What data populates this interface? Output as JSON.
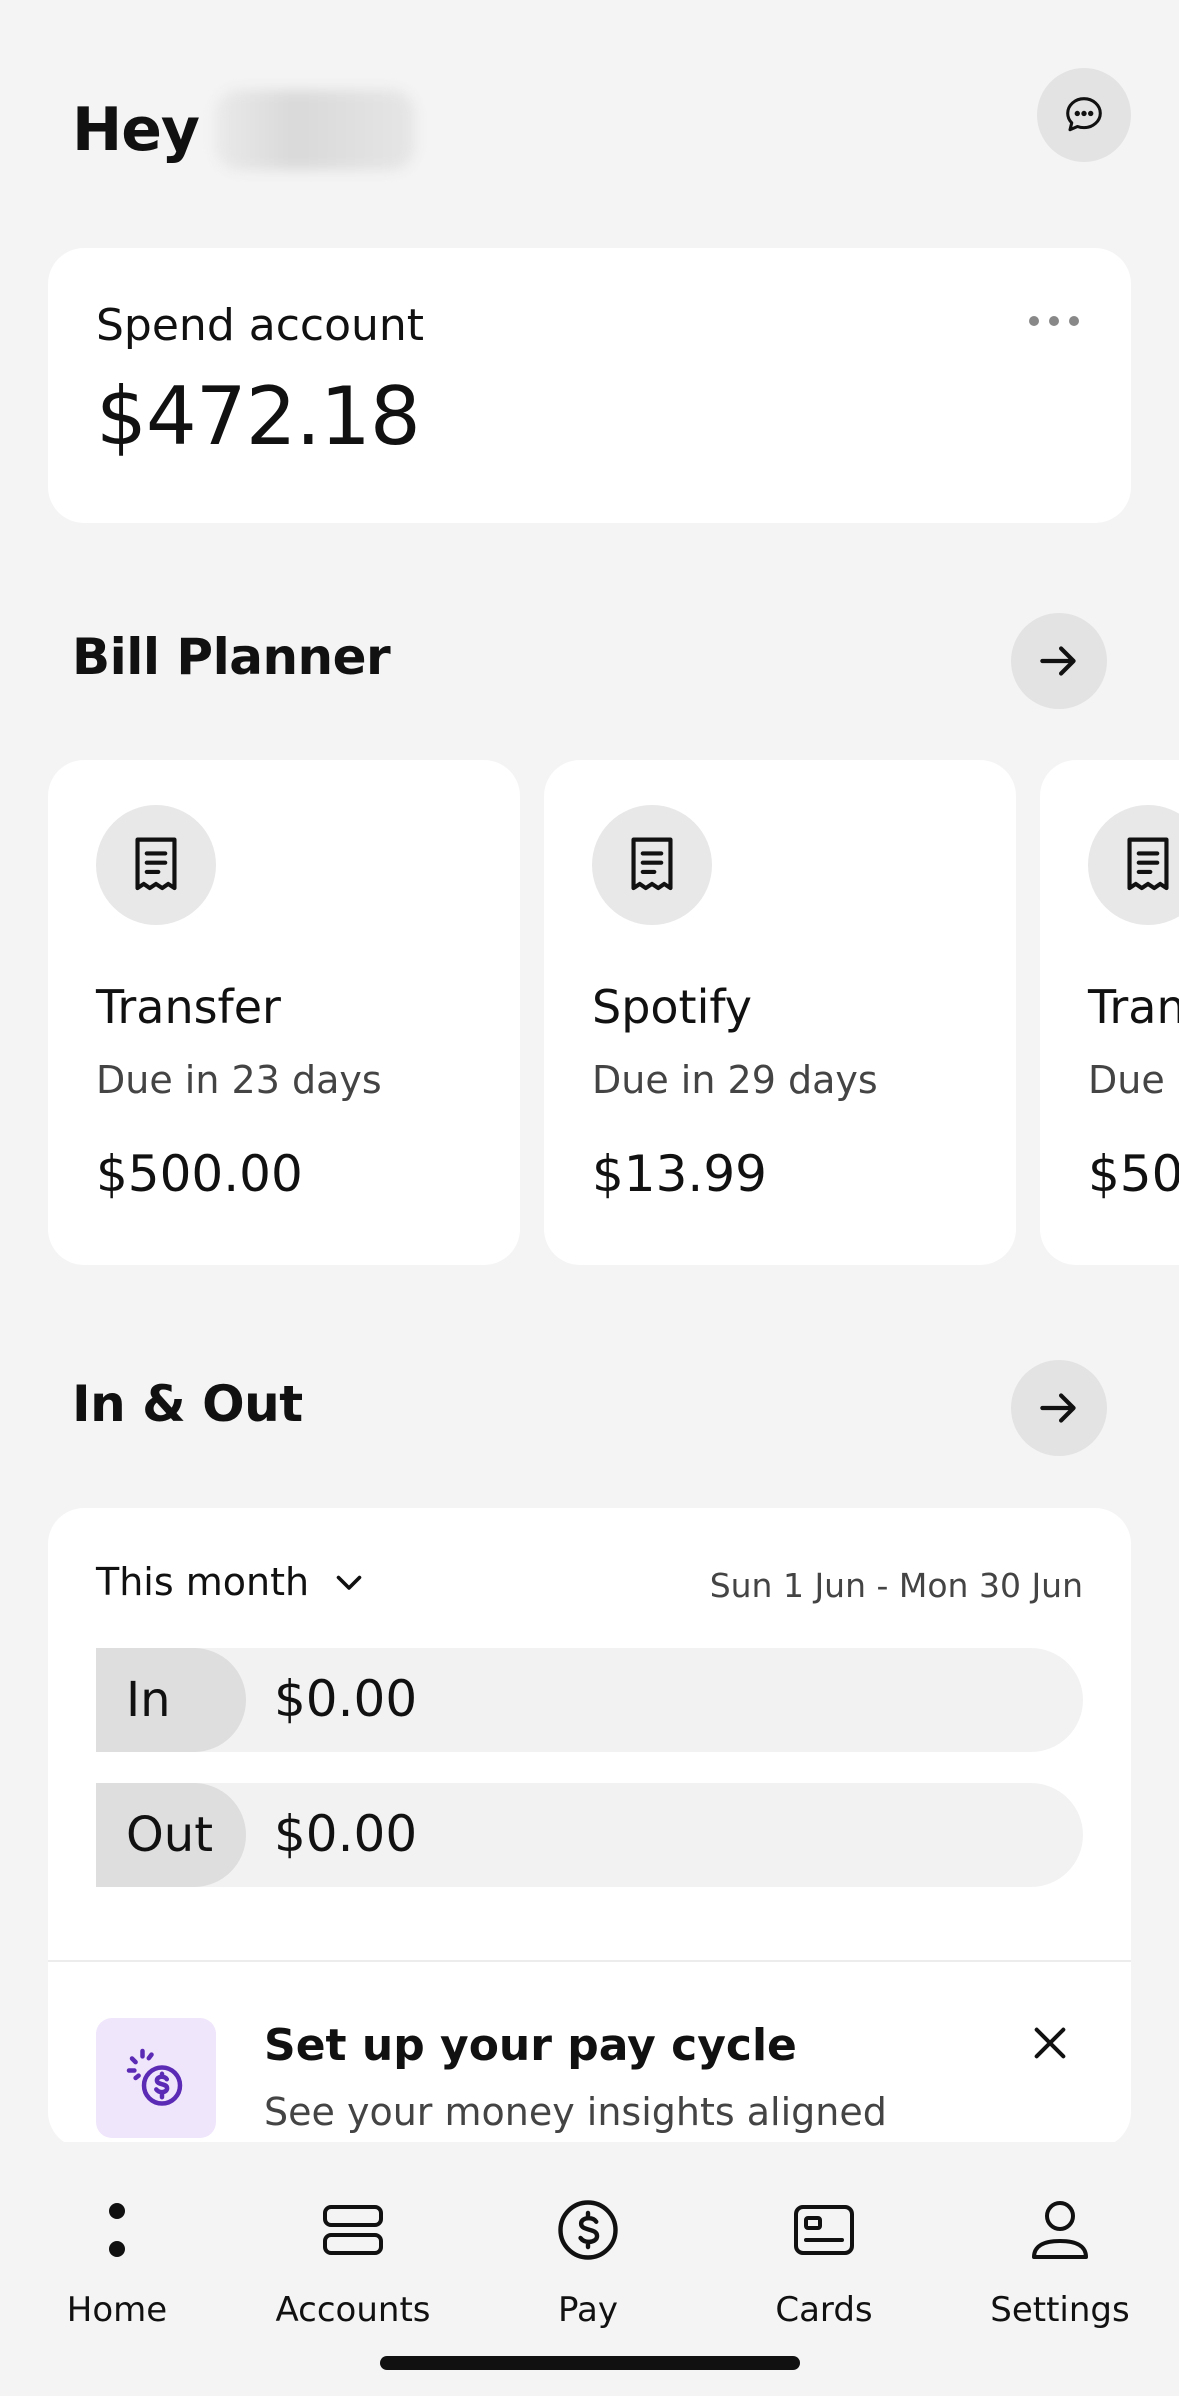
{
  "header": {
    "greeting": "Hey"
  },
  "spend_account": {
    "label": "Spend account",
    "balance": "$472.18"
  },
  "bill_planner": {
    "title": "Bill Planner",
    "bills": [
      {
        "name": "Transfer",
        "due": "Due in 23 days",
        "amount": "$500.00"
      },
      {
        "name": "Spotify",
        "due": "Due in 29 days",
        "amount": "$13.99"
      },
      {
        "name": "Tran",
        "due": "Due i",
        "amount": "$50"
      }
    ]
  },
  "in_out": {
    "title": "In & Out",
    "period": "This month",
    "date_range": "Sun 1 Jun - Mon 30 Jun",
    "in_label": "In",
    "in_value": "$0.00",
    "out_label": "Out",
    "out_value": "$0.00"
  },
  "pay_cycle": {
    "title": "Set up your pay cycle",
    "subtitle": "See your money insights aligned"
  },
  "tabs": [
    {
      "label": "Home",
      "icon": "home-dot-icon"
    },
    {
      "label": "Accounts",
      "icon": "accounts-icon"
    },
    {
      "label": "Pay",
      "icon": "dollar-circle-icon"
    },
    {
      "label": "Cards",
      "icon": "card-icon"
    },
    {
      "label": "Settings",
      "icon": "person-icon"
    }
  ],
  "colors": {
    "background": "#f4f4f4",
    "card": "#ffffff",
    "accent_purple": "#5b2bb5"
  }
}
